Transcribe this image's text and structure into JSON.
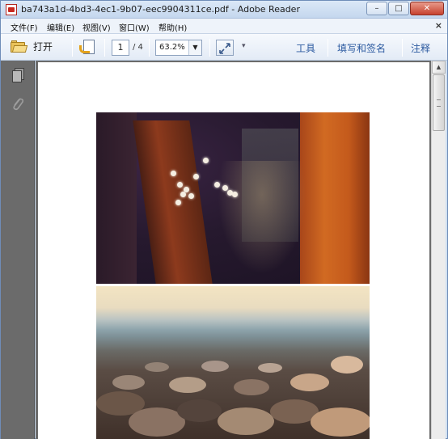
{
  "window": {
    "title": "ba743a1d-4bd3-4ec1-9b07-eec9904311ce.pdf - Adobe Reader",
    "controls": {
      "minimize": "–",
      "maximize": "□",
      "close": "✕"
    }
  },
  "menu": {
    "items": [
      "文件(F)",
      "编辑(E)",
      "视图(V)",
      "窗口(W)",
      "帮助(H)"
    ],
    "close_doc": "×"
  },
  "toolbar": {
    "open_label": "打开",
    "page_current": "1",
    "page_total": "/ 4",
    "zoom_value": "63.2%",
    "zoom_dropdown_glyph": "▼",
    "more_glyph": "▾",
    "tools_label": "工具",
    "fill_sign_label": "填写和签名",
    "comment_label": "注释"
  },
  "scrollbar": {
    "up_glyph": "▲"
  }
}
